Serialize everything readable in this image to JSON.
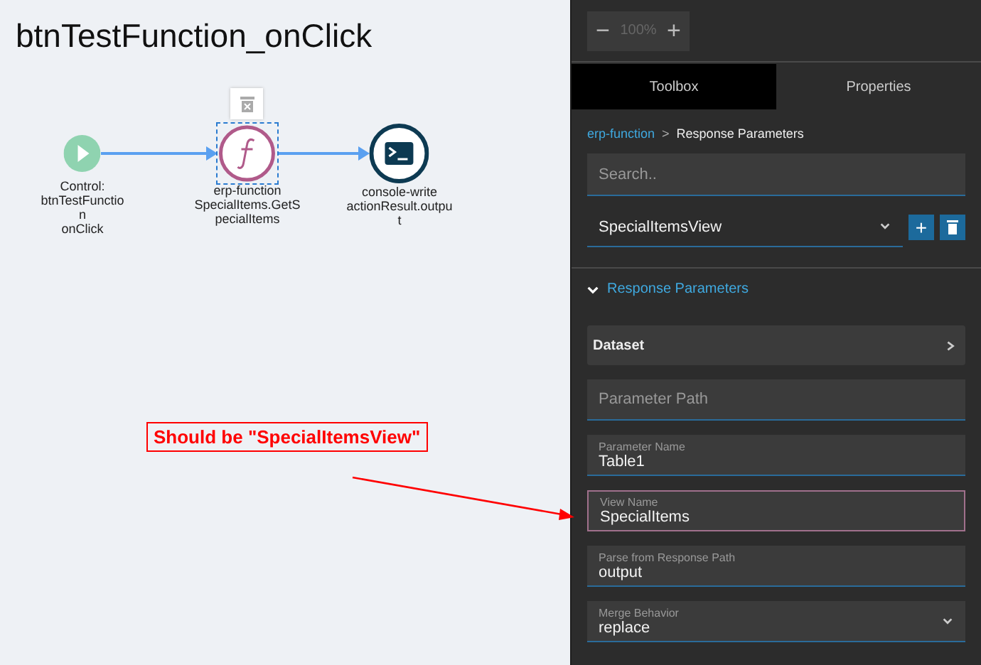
{
  "canvas": {
    "title": "btnTestFunction_onClick",
    "nodes": [
      {
        "kind": "start",
        "lines": [
          "Control:",
          "btnTestFunctio",
          "n",
          "onClick"
        ],
        "selected": false
      },
      {
        "kind": "function",
        "lines": [
          "erp-function",
          "SpecialItems.GetS",
          "pecialItems"
        ],
        "selected": true
      },
      {
        "kind": "console",
        "lines": [
          "console-write",
          "actionResult.outpu",
          "t"
        ],
        "selected": false
      }
    ],
    "annotation": "Should be \"SpecialItemsView\""
  },
  "panel": {
    "zoom": {
      "minus": "−",
      "value": "100%",
      "plus": "+"
    },
    "tabs": [
      {
        "label": "Toolbox",
        "selected": false
      },
      {
        "label": "Properties",
        "selected": true
      }
    ],
    "breadcrumb": {
      "link": "erp-function",
      "separator": ">",
      "current": "Response Parameters"
    },
    "search": {
      "placeholder": "Search.."
    },
    "view_select": {
      "value": "SpecialItemsView",
      "add": "+"
    },
    "section": {
      "title": "Response Parameters",
      "expanded": true
    },
    "fields": [
      {
        "kind": "group",
        "label": "Dataset"
      },
      {
        "kind": "input",
        "placeholder": "Parameter Path",
        "focused": false
      },
      {
        "kind": "input",
        "label": "Parameter Name",
        "value": "Table1",
        "focused": false
      },
      {
        "kind": "input",
        "label": "View Name",
        "value": "SpecialItems",
        "focused": true
      },
      {
        "kind": "input",
        "label": "Parse from Response Path",
        "value": "output",
        "focused": false
      },
      {
        "kind": "select",
        "label": "Merge Behavior",
        "value": "replace",
        "focused": false
      }
    ]
  }
}
